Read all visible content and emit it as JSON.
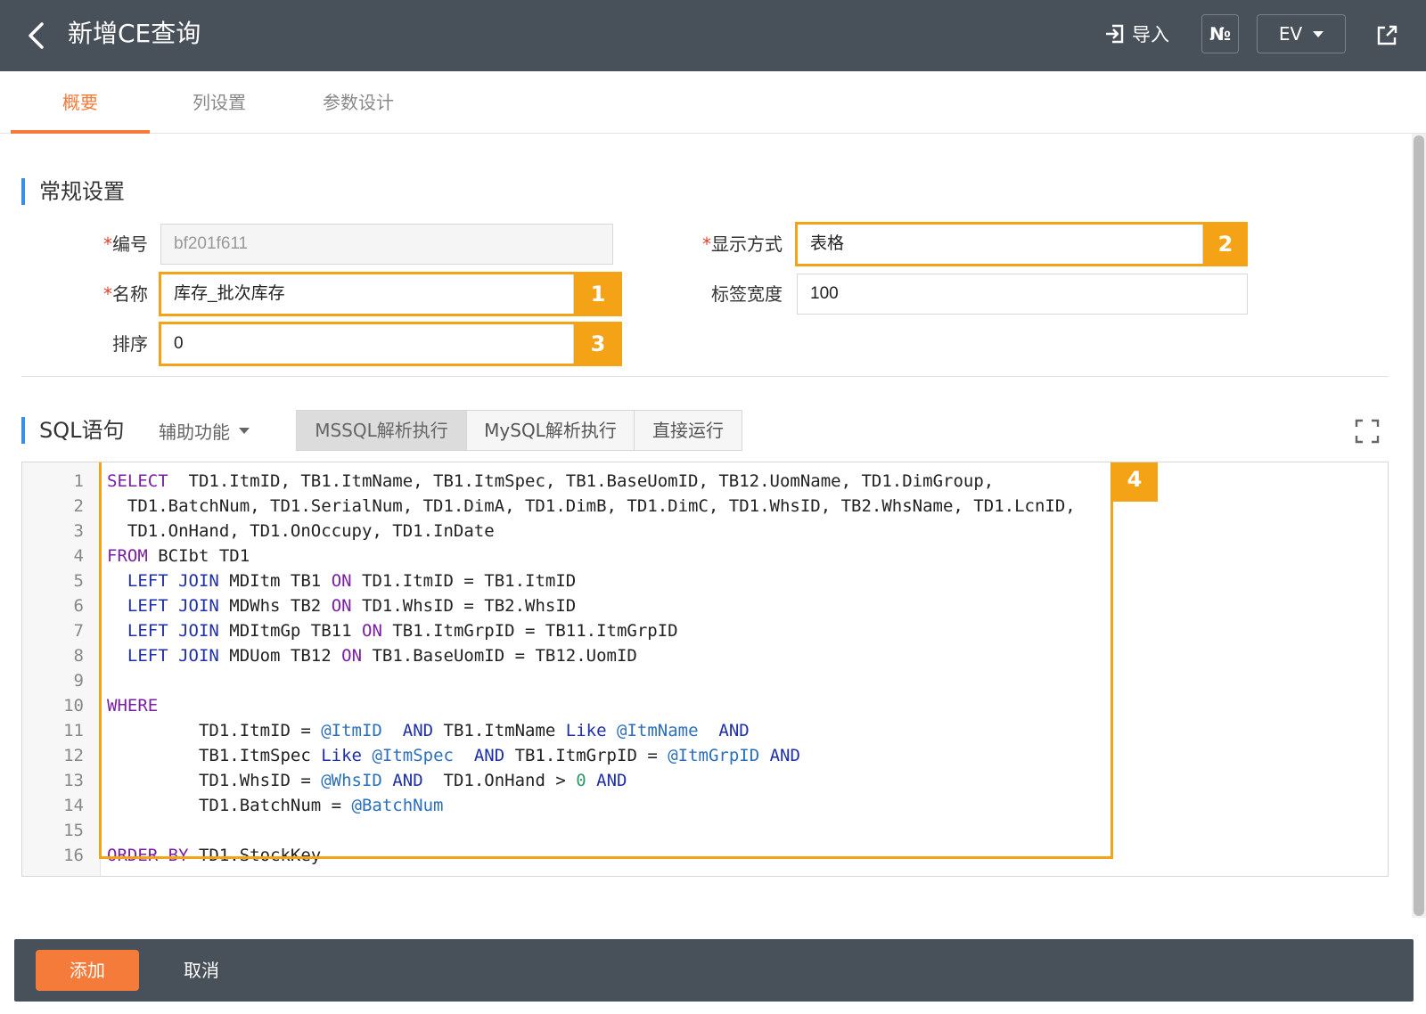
{
  "header": {
    "title": "新增CE查询",
    "import_label": "导入",
    "no_label": "№",
    "lang_label": "EV"
  },
  "tabs": [
    {
      "label": "概要",
      "active": true
    },
    {
      "label": "列设置",
      "active": false
    },
    {
      "label": "参数设计",
      "active": false
    }
  ],
  "general": {
    "section_title": "常规设置",
    "code": {
      "label": "编号",
      "required": true,
      "value": "bf201f611"
    },
    "name": {
      "label": "名称",
      "required": true,
      "value": "库存_批次库存"
    },
    "order": {
      "label": "排序",
      "required": false,
      "value": "0"
    },
    "display": {
      "label": "显示方式",
      "required": true,
      "value": "表格"
    },
    "label_width": {
      "label": "标签宽度",
      "required": false,
      "value": "100"
    }
  },
  "callouts": [
    "1",
    "2",
    "3",
    "4"
  ],
  "sql": {
    "section_title": "SQL语句",
    "assist_label": "辅助功能",
    "buttons": [
      "MSSQL解析执行",
      "MySQL解析执行",
      "直接运行"
    ],
    "line_numbers": [
      "1",
      "2",
      "3",
      "4",
      "5",
      "6",
      "7",
      "8",
      "9",
      "10",
      "11",
      "12",
      "13",
      "14",
      "15",
      "16"
    ]
  },
  "footer": {
    "add_label": "添加",
    "cancel_label": "取消"
  },
  "colors": {
    "accent": "#f47b3a",
    "callout": "#f5a316",
    "header_bg": "#485059",
    "section_marker": "#3a8ee6"
  }
}
